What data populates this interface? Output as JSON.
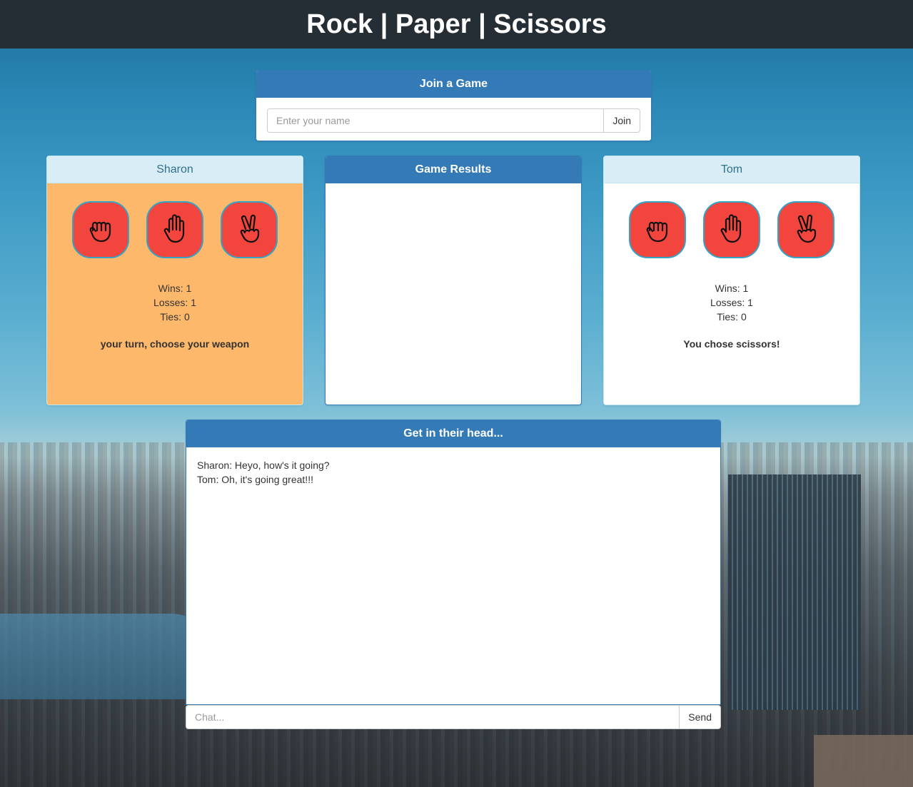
{
  "header": {
    "title": "Rock | Paper | Scissors"
  },
  "join": {
    "heading": "Join a Game",
    "name_placeholder": "Enter your name",
    "join_label": "Join"
  },
  "player1": {
    "name": "Sharon",
    "wins": "Wins: 1",
    "losses": "Losses: 1",
    "ties": "Ties: 0",
    "status": "your turn, choose your weapon",
    "highlight_color": "#fdb86c",
    "weapons": [
      "rock-icon",
      "paper-icon",
      "scissors-icon"
    ]
  },
  "results": {
    "heading": "Game Results"
  },
  "player2": {
    "name": "Tom",
    "wins": "Wins: 1",
    "losses": "Losses: 1",
    "ties": "Ties: 0",
    "status": "You chose scissors!",
    "weapons": [
      "rock-icon",
      "paper-icon",
      "scissors-icon"
    ]
  },
  "chat": {
    "heading": "Get in their head...",
    "messages": [
      "Sharon: Heyo, how's it going?",
      "Tom: Oh, it's going great!!!"
    ],
    "input_placeholder": "Chat...",
    "send_label": "Send"
  },
  "colors": {
    "navbar": "#252d35",
    "primary": "#337ab7",
    "weapon_fill": "#f2453d",
    "weapon_border": "#31a4c7"
  }
}
